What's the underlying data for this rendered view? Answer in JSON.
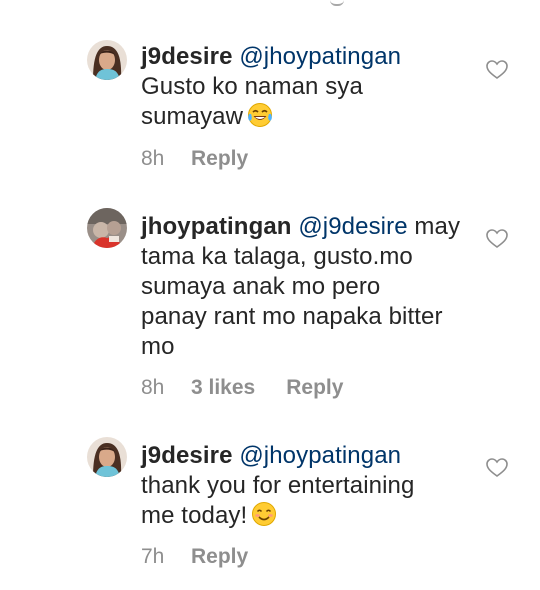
{
  "comments": [
    {
      "username": "j9desire",
      "mention": "@jhoypatingan",
      "text_lines": [
        "Gusto ko naman sya",
        "sumayaw"
      ],
      "emoji": "tears-of-joy-emoji",
      "timestamp": "8h",
      "likes": "",
      "reply_label": "Reply"
    },
    {
      "username": "jhoypatingan",
      "mention": "@j9desire",
      "text_first": "may",
      "text_lines": [
        "tama ka talaga, gusto.mo",
        "sumaya anak mo pero",
        "panay rant mo napaka bitter",
        "mo"
      ],
      "timestamp": "8h",
      "likes": "3 likes",
      "reply_label": "Reply"
    },
    {
      "username": "j9desire",
      "mention": "@jhoypatingan",
      "text_lines": [
        "thank you for entertaining",
        "me today!"
      ],
      "emoji": "smiling-face-emoji",
      "timestamp": "7h",
      "likes": "",
      "reply_label": "Reply"
    }
  ],
  "icons": {
    "like": "heart-outline-icon"
  },
  "colors": {
    "text": "#262626",
    "mention": "#003569",
    "meta": "#8e8e8e",
    "background": "#ffffff"
  }
}
